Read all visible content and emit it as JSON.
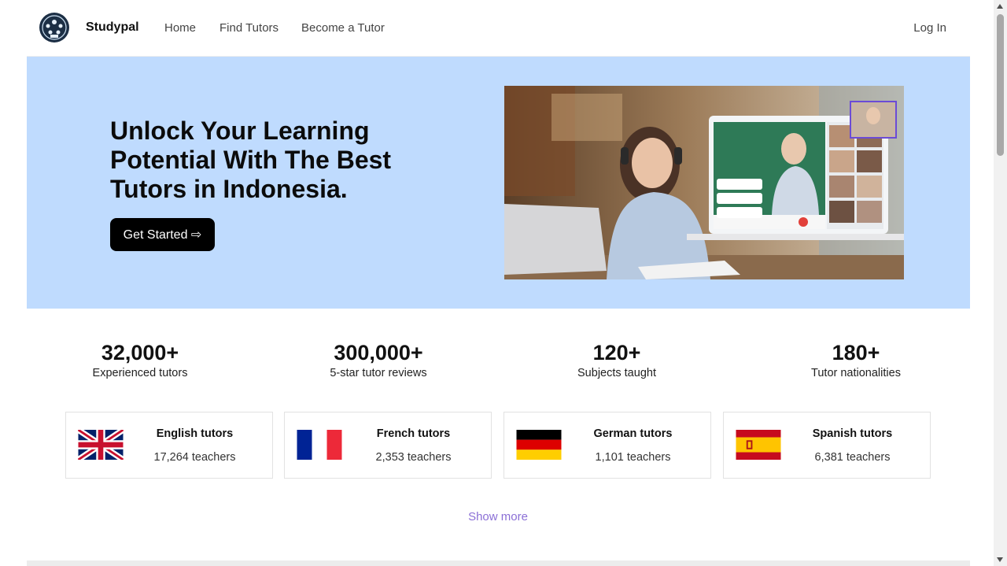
{
  "nav": {
    "brand": "Studypal",
    "links": [
      "Home",
      "Find Tutors",
      "Become a Tutor"
    ],
    "login": "Log In"
  },
  "hero": {
    "title_lines": [
      "Unlock Your Learning",
      "Potential With The Best",
      "Tutors in Indonesia."
    ],
    "cta": "Get Started ⇨",
    "background": "#bfdbfe"
  },
  "stats": [
    {
      "value": "32,000+",
      "label": "Experienced tutors"
    },
    {
      "value": "300,000+",
      "label": "5-star tutor reviews"
    },
    {
      "value": "120+",
      "label": "Subjects taught"
    },
    {
      "value": "180+",
      "label": "Tutor nationalities"
    }
  ],
  "languages": [
    {
      "title": "English tutors",
      "count": "17,264 teachers",
      "flag": "uk-flag-icon"
    },
    {
      "title": "French tutors",
      "count": "2,353 teachers",
      "flag": "france-flag-icon"
    },
    {
      "title": "German tutors",
      "count": "1,101 teachers",
      "flag": "germany-flag-icon"
    },
    {
      "title": "Spanish tutors",
      "count": "6,381 teachers",
      "flag": "spain-flag-icon"
    }
  ],
  "show_more": "Show more",
  "colors": {
    "accent_link": "#8b6fd6",
    "cta_bg": "#000000"
  }
}
